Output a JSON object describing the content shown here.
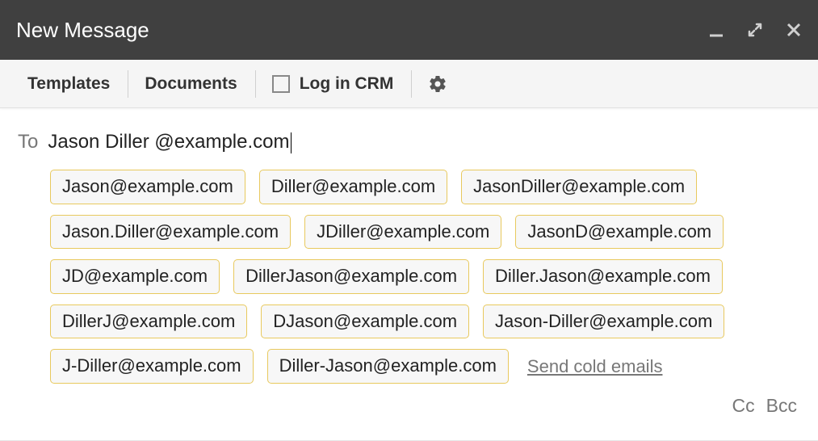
{
  "window": {
    "title": "New Message"
  },
  "toolbar": {
    "templates": "Templates",
    "documents": "Documents",
    "log_in_crm": "Log in CRM"
  },
  "compose": {
    "to_label": "To",
    "to_value": "Jason Diller @example.com",
    "cc_label": "Cc",
    "bcc_label": "Bcc",
    "cold_emails_link": "Send cold emails",
    "suggested_emails": [
      "Jason@example.com",
      "Diller@example.com",
      "JasonDiller@example.com",
      "Jason.Diller@example.com",
      "JDiller@example.com",
      "JasonD@example.com",
      "JD@example.com",
      "DillerJason@example.com",
      "Diller.Jason@example.com",
      "DillerJ@example.com",
      "DJason@example.com",
      "Jason-Diller@example.com",
      "J-Diller@example.com",
      "Diller-Jason@example.com"
    ]
  }
}
